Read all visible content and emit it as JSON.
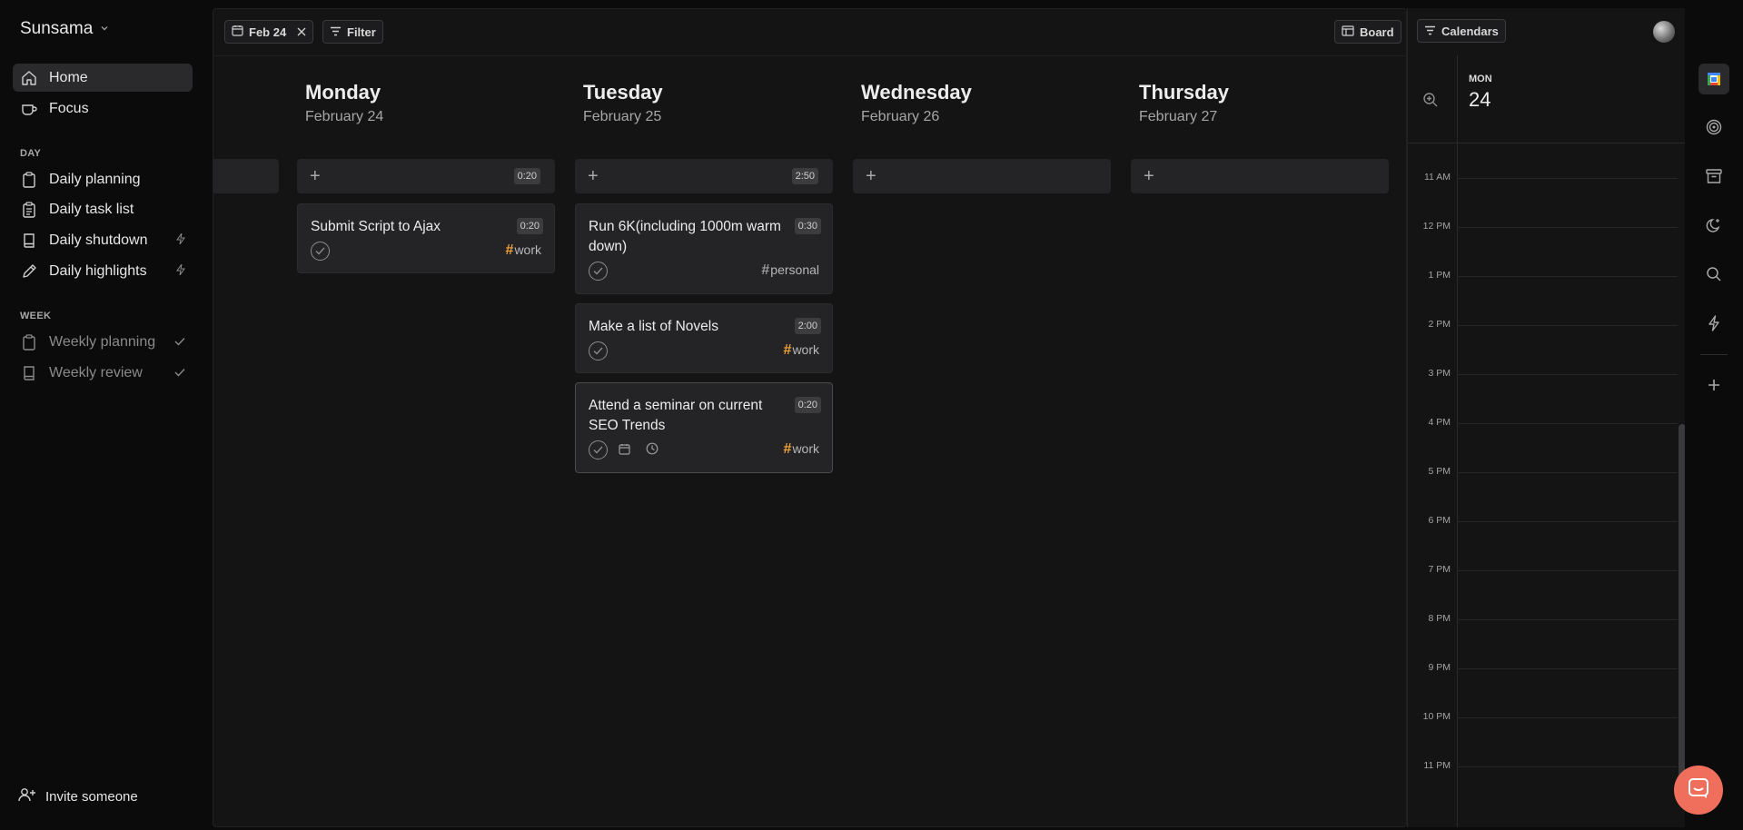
{
  "sidebar": {
    "workspace": "Sunsama",
    "nav": [
      {
        "label": "Home"
      },
      {
        "label": "Focus"
      }
    ],
    "day_section": "DAY",
    "day_items": [
      {
        "label": "Daily planning"
      },
      {
        "label": "Daily task list"
      },
      {
        "label": "Daily shutdown"
      },
      {
        "label": "Daily highlights"
      }
    ],
    "week_section": "WEEK",
    "week_items": [
      {
        "label": "Weekly planning"
      },
      {
        "label": "Weekly review"
      }
    ],
    "invite": "Invite someone"
  },
  "toolbar": {
    "date_chip": "Feb 24",
    "filter": "Filter",
    "board": "Board",
    "calendars": "Calendars"
  },
  "days": [
    {
      "name": "Monday",
      "date": "February 24",
      "total": "0:20",
      "tasks": [
        {
          "title": "Submit Script to Ajax",
          "duration": "0:20",
          "tag": "work"
        }
      ]
    },
    {
      "name": "Tuesday",
      "date": "February 25",
      "total": "2:50",
      "tasks": [
        {
          "title": "Run 6K(including 1000m warm down)",
          "duration": "0:30",
          "tag": "personal"
        },
        {
          "title": "Make a list of Novels",
          "duration": "2:00",
          "tag": "work"
        },
        {
          "title": "Attend a seminar on current SEO Trends",
          "duration": "0:20",
          "tag": "work"
        }
      ]
    },
    {
      "name": "Wednesday",
      "date": "February 26",
      "total": "",
      "tasks": []
    },
    {
      "name": "Thursday",
      "date": "February 27",
      "total": "",
      "tasks": []
    }
  ],
  "calendar": {
    "day_abbr": "MON",
    "day_num": "24",
    "hours": [
      "11 AM",
      "12 PM",
      "1 PM",
      "2 PM",
      "3 PM",
      "4 PM",
      "5 PM",
      "6 PM",
      "7 PM",
      "8 PM",
      "9 PM",
      "10 PM",
      "11 PM"
    ]
  },
  "rail_icons": [
    "google-calendar-icon",
    "target-icon",
    "archive-icon",
    "moon-icon",
    "search-icon",
    "bolt-icon",
    "plus-icon"
  ],
  "colors": {
    "tag_work": "#f0a43a",
    "chat_bubble": "#ef6f5c"
  }
}
